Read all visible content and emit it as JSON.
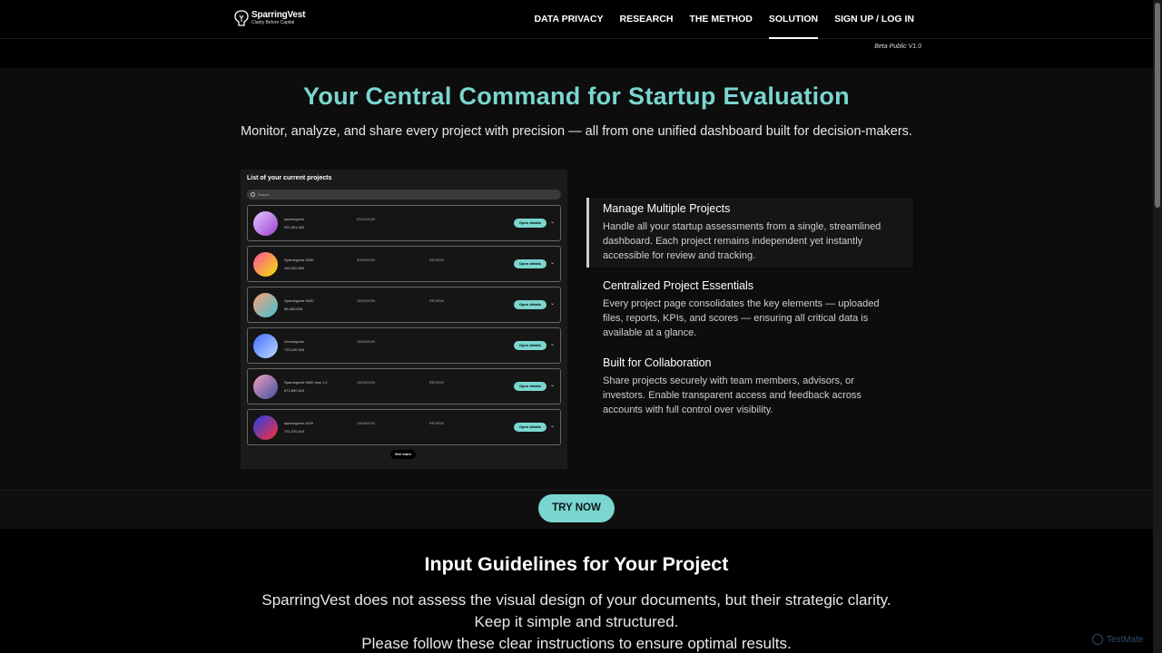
{
  "header": {
    "logo_name": "SparringVest",
    "logo_tagline": "Clarity Before Capital",
    "nav": [
      {
        "label": "DATA PRIVACY"
      },
      {
        "label": "RESEARCH"
      },
      {
        "label": "THE METHOD"
      },
      {
        "label": "SOLUTION"
      },
      {
        "label": "SIGN UP / LOG IN"
      }
    ],
    "active_nav": "SOLUTION",
    "beta_label": "Beta Public V1.0"
  },
  "hero": {
    "title": "Your Central Command for Startup Evaluation",
    "subtitle": "Monitor, analyze, and share every project with precision — all from one unified dashboard built for decision-makers."
  },
  "dashboard": {
    "title": "List of your current projects",
    "search_placeholder": "Search",
    "projects": [
      {
        "name": "sparringvest",
        "amount": "922,401,000",
        "date": "03/10/2025",
        "status": "-",
        "button": "Open details",
        "colors": [
          "#e0c8ff",
          "#a040d0"
        ]
      },
      {
        "name": "Sparringvest 3030",
        "amount": "164,020,550",
        "date": "30/09/2025",
        "status": "REVIEW",
        "button": "Open details",
        "colors": [
          "#ff4fa0",
          "#f2e400"
        ]
      },
      {
        "name": "Sparringvest 3030",
        "amount": "88,283,828",
        "date": "28/09/2025",
        "status": "REVIEW",
        "button": "Open details",
        "colors": [
          "#ffa07a",
          "#40c0d0"
        ]
      },
      {
        "name": "Greenspace",
        "amount": "733,100,016",
        "date": "18/09/2025",
        "status": "-",
        "button": "Open details",
        "colors": [
          "#3f6fff",
          "#c0d8ff"
        ]
      },
      {
        "name": "Sparringvest 9000 new 1.2",
        "amount": "671,890,815",
        "date": "15/09/2025",
        "status": "REVIEW",
        "button": "Open details",
        "colors": [
          "#f0a0c0",
          "#4050a0"
        ]
      },
      {
        "name": "sparringvest 1009",
        "amount": "731,370,010",
        "date": "13/09/2025",
        "status": "REVIEW",
        "button": "Open details",
        "colors": [
          "#2040f0",
          "#ff3030"
        ]
      }
    ],
    "see_more": "See more"
  },
  "features": [
    {
      "title": "Manage Multiple Projects",
      "text": "Handle all your startup assessments from a single, streamlined dashboard. Each project remains independent yet instantly accessible for review and tracking."
    },
    {
      "title": "Centralized Project Essentials",
      "text": "Every project page consolidates the key elements — uploaded files, reports, KPIs, and scores — ensuring all critical data is available at a glance."
    },
    {
      "title": "Built for Collaboration",
      "text": "Share projects securely with team members, advisors, or investors. Enable transparent access and feedback across accounts with full control over visibility."
    }
  ],
  "cta": {
    "label": "TRY NOW"
  },
  "guidelines": {
    "title": "Input Guidelines for Your Project",
    "line1": "SparringVest does not assess the visual design of your documents, but their strategic clarity.",
    "line2": "Keep it simple and structured.",
    "line3": "Please follow these clear instructions to ensure optimal results."
  },
  "watermark": "TestMate"
}
